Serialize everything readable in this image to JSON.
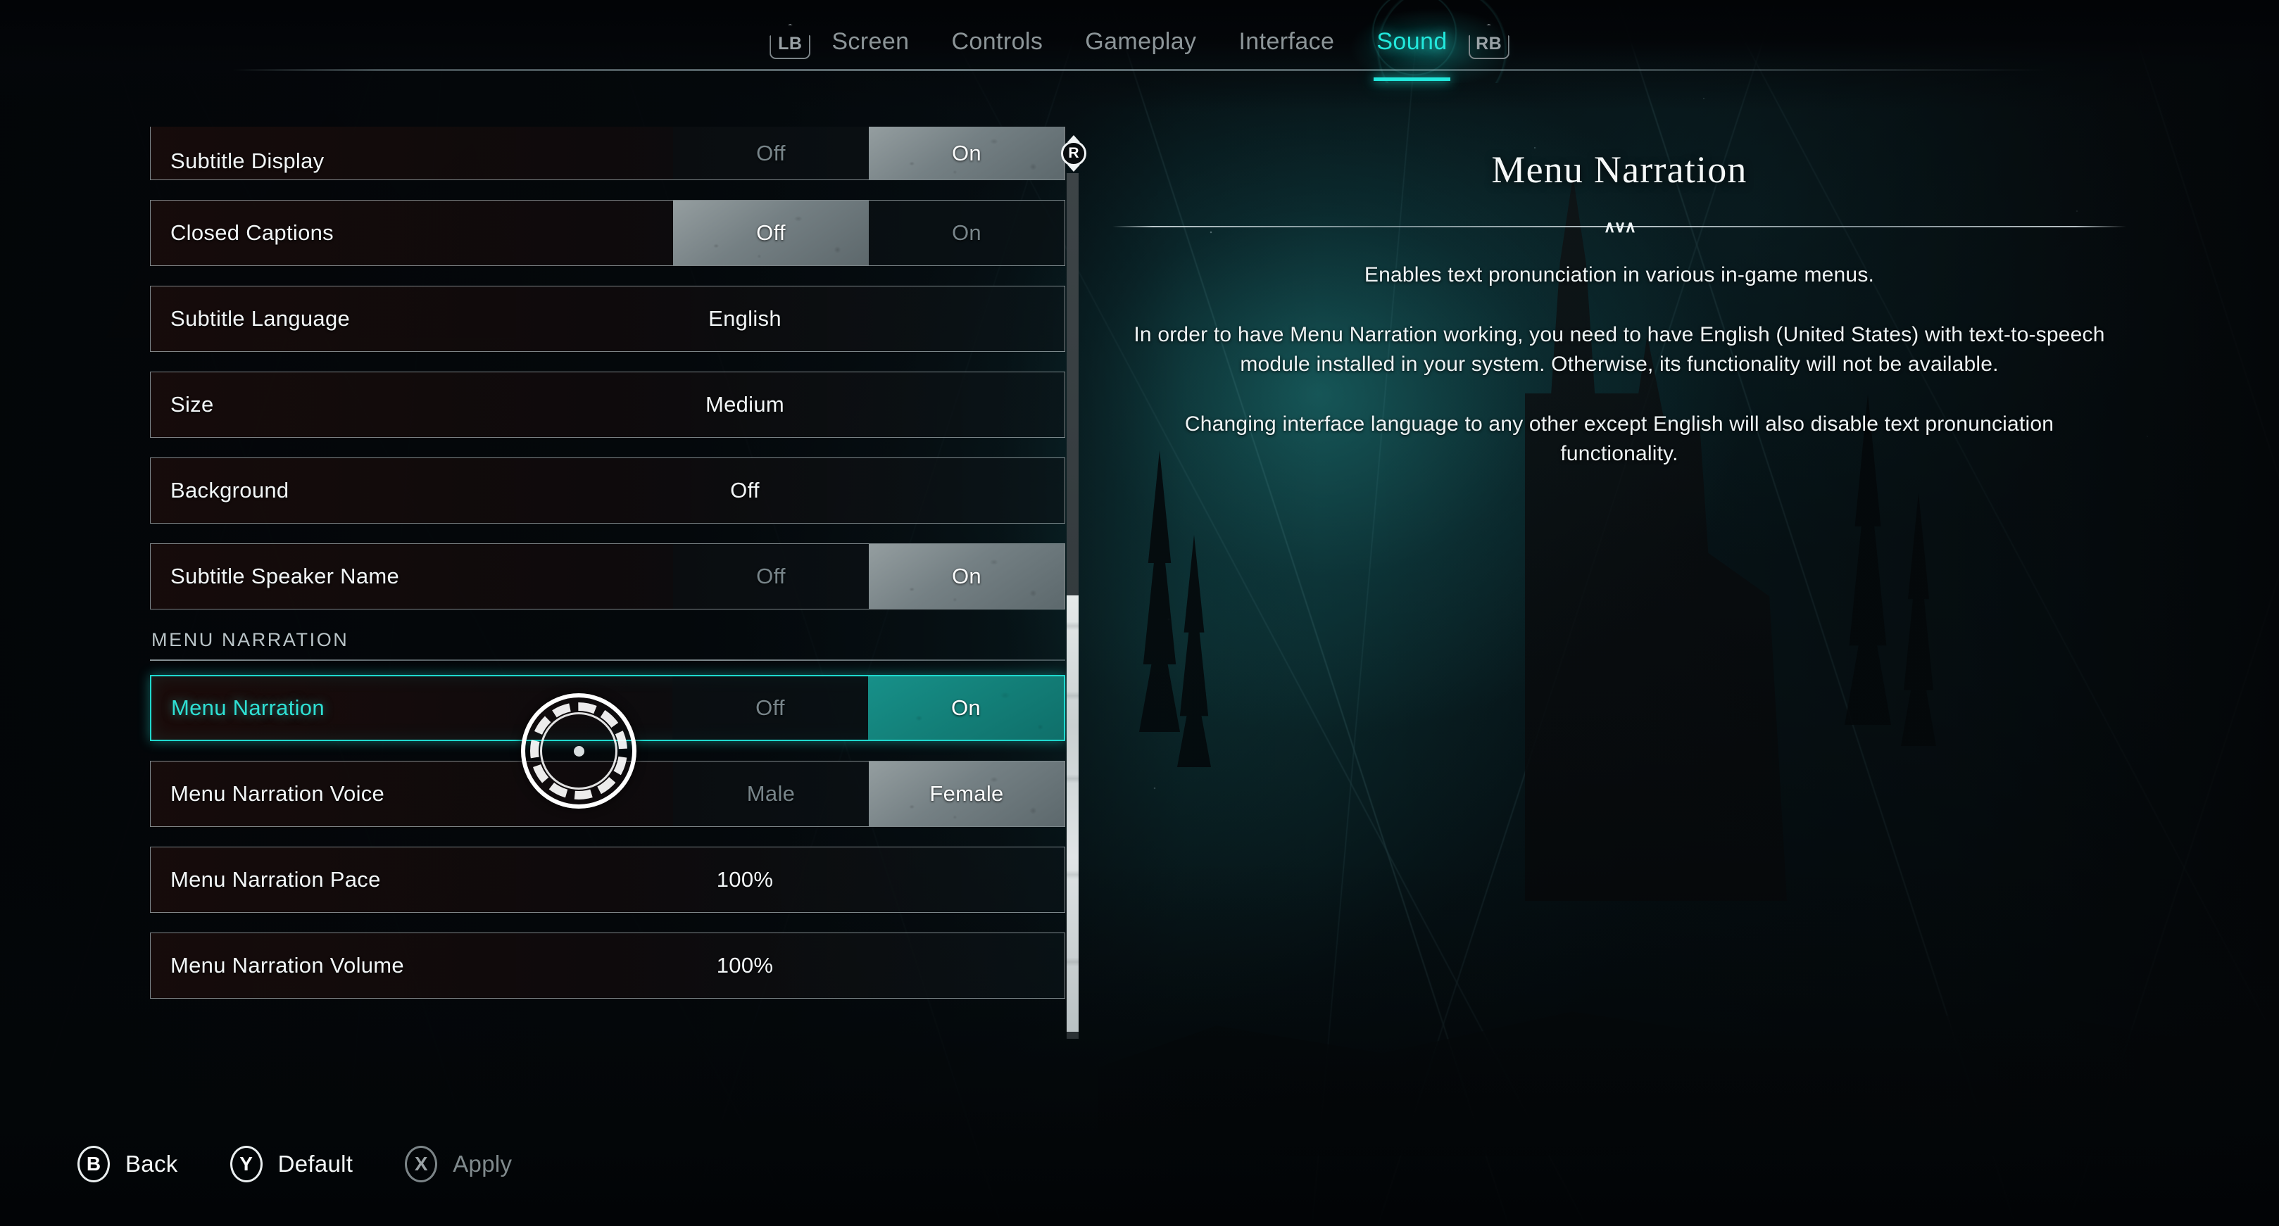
{
  "nav": {
    "left_shoulder": "LB",
    "right_shoulder": "RB",
    "tabs": [
      {
        "label": "Screen",
        "active": false
      },
      {
        "label": "Controls",
        "active": false
      },
      {
        "label": "Gameplay",
        "active": false
      },
      {
        "label": "Interface",
        "active": false
      },
      {
        "label": "Sound",
        "active": true
      }
    ]
  },
  "settings": {
    "rows": [
      {
        "label": "Subtitle Display",
        "type": "toggle",
        "options": [
          "Off",
          "On"
        ],
        "selected": "On",
        "clipped": true
      },
      {
        "label": "Closed Captions",
        "type": "toggle",
        "options": [
          "Off",
          "On"
        ],
        "selected": "Off"
      },
      {
        "label": "Subtitle Language",
        "type": "value",
        "value": "English"
      },
      {
        "label": "Size",
        "type": "value",
        "value": "Medium"
      },
      {
        "label": "Background",
        "type": "value",
        "value": "Off"
      },
      {
        "label": "Subtitle Speaker Name",
        "type": "toggle",
        "options": [
          "Off",
          "On"
        ],
        "selected": "On"
      }
    ],
    "section_header": "MENU NARRATION",
    "section_rows": [
      {
        "label": "Menu Narration",
        "type": "toggle",
        "options": [
          "Off",
          "On"
        ],
        "selected": "On",
        "highlighted": true
      },
      {
        "label": "Menu Narration Voice",
        "type": "toggle",
        "options": [
          "Male",
          "Female"
        ],
        "selected": "Female"
      },
      {
        "label": "Menu Narration Pace",
        "type": "value",
        "value": "100%"
      },
      {
        "label": "Menu Narration Volume",
        "type": "value",
        "value": "100%"
      }
    ]
  },
  "scroll": {
    "stick_label": "R",
    "stick_icon": "right-stick-scroll-icon"
  },
  "detail": {
    "title": "Menu Narration",
    "divider_ornament": "∧∨∧",
    "paragraphs": [
      "Enables text pronunciation in various in-game menus.",
      "In order to have Menu Narration working, you need to have English (United States) with text-to-speech module installed in your system. Otherwise, its functionality will not be available.",
      "Changing interface language to any other except English will also disable text pronunciation functionality."
    ]
  },
  "actions": [
    {
      "glyph": "B",
      "label": "Back",
      "disabled": false
    },
    {
      "glyph": "Y",
      "label": "Default",
      "disabled": false
    },
    {
      "glyph": "X",
      "label": "Apply",
      "disabled": true
    }
  ],
  "colors": {
    "accent_cyan": "#22e8dc",
    "accent_teal_fill": "#14807a",
    "selected_border": "#1fd9ce",
    "row_border": "#c4d0d4",
    "text_primary": "#f2f6f7",
    "text_dim": "#78858a"
  }
}
